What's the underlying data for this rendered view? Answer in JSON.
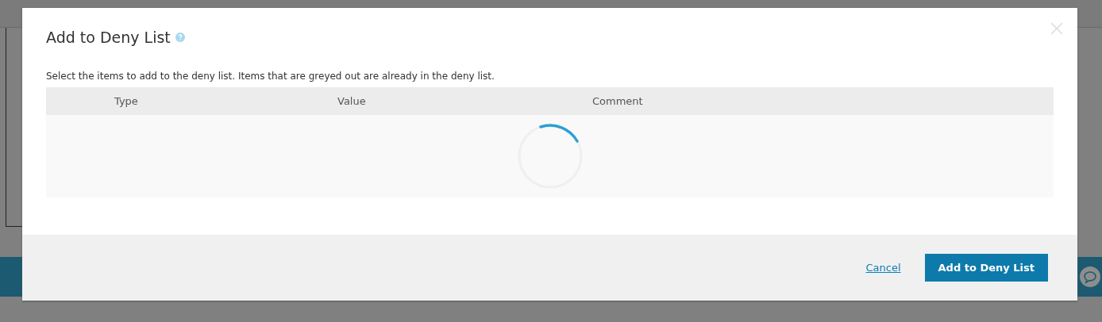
{
  "dialog": {
    "title": "Add to Deny List",
    "description": "Select the items to add to the deny list. Items that are greyed out are already in the deny list.",
    "table": {
      "columns": [
        "Type",
        "Value",
        "Comment"
      ],
      "loading": true
    },
    "buttons": [
      {
        "label": "Cancel",
        "kind": "link"
      },
      {
        "label": "Add to Deny List",
        "kind": "primary"
      }
    ]
  }
}
